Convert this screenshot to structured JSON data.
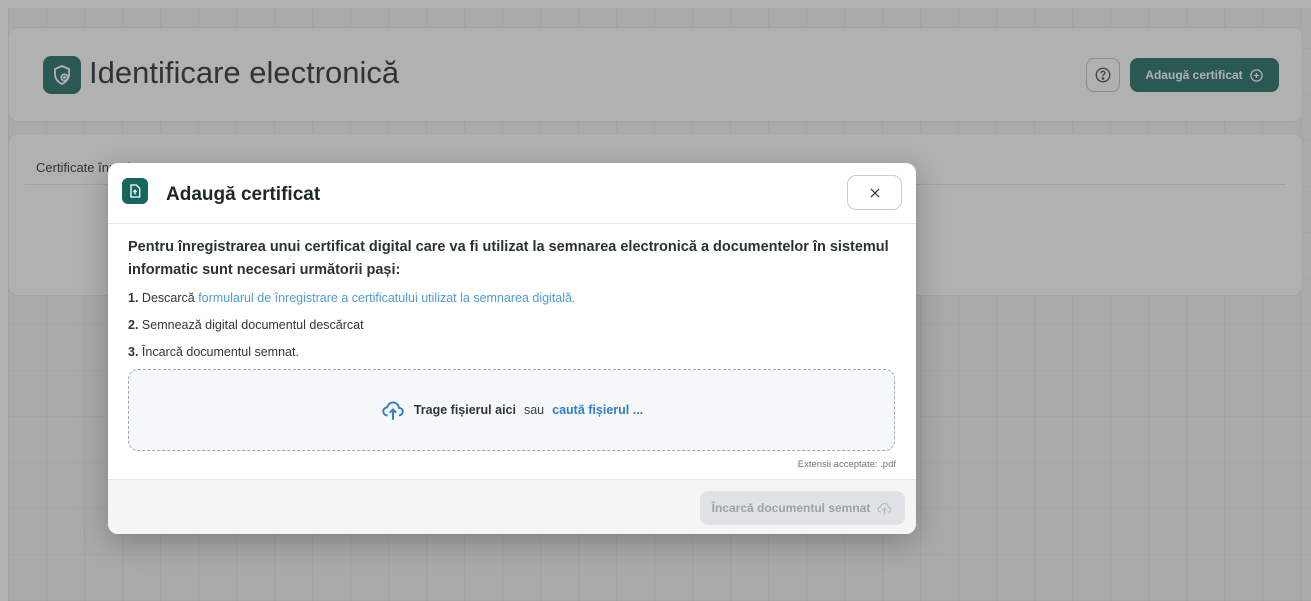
{
  "header": {
    "title": "Identificare electronică",
    "add_certificate_label": "Adaugă certificat"
  },
  "list": {
    "title": "Certificate înregistrate"
  },
  "modal": {
    "title": "Adaugă certificat",
    "intro": "Pentru înregistrarea unui certificat digital care va fi utilizat la semnarea electronică a documentelor în sistemul informatic sunt necesari următorii pași:",
    "steps": [
      {
        "num": "1.",
        "prefix": "Descarcă",
        "link": "formularul de înregistrare a certificatului utilizat la semnarea digitală."
      },
      {
        "num": "2.",
        "text": "Semnează digital documentul descărcat"
      },
      {
        "num": "3.",
        "text": "Încarcă documentul semnat."
      }
    ],
    "dropzone": {
      "main": "Trage fișierul aici",
      "or": "sau",
      "browse": "caută fișierul ..."
    },
    "accepted_ext": "Extensii acceptate: .pdf",
    "upload_label": "Încarcă documentul semnat"
  },
  "colors": {
    "primary": "#17665e",
    "link": "#4f9bd9",
    "disabled_bg": "#dfe3e5"
  },
  "icons": [
    "shield-certificate-icon",
    "help-icon",
    "plus-circle-icon",
    "file-upload-icon",
    "close-icon",
    "cloud-upload-icon"
  ]
}
